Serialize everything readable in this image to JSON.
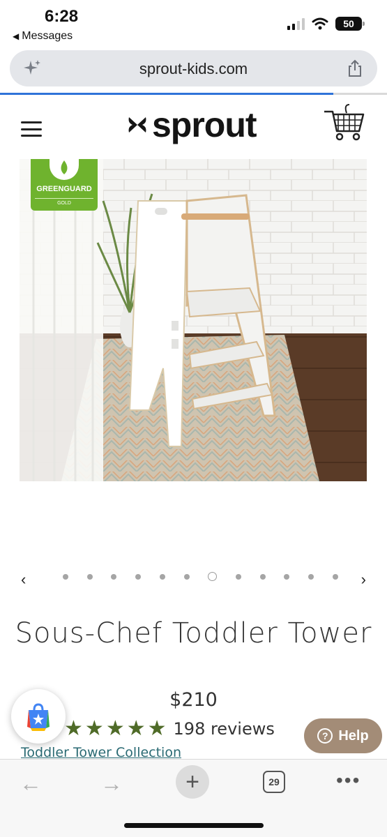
{
  "status_bar": {
    "time": "6:28",
    "back_label": "Messages",
    "battery": "50"
  },
  "address_bar": {
    "url": "sprout-kids.com",
    "icons": [
      "sparkle-icon",
      "share-icon"
    ]
  },
  "site_header": {
    "logo_text": "sprout",
    "icons": [
      "menu-icon",
      "cart-icon"
    ]
  },
  "product_image": {
    "badge_title": "GREENGUARD",
    "badge_level": "GOLD"
  },
  "carousel": {
    "dot_count": 12,
    "active_index": 6
  },
  "product": {
    "title": "Sous-Chef Toddler Tower",
    "price": "$210",
    "rating": 5,
    "reviews": "198 reviews",
    "collection_link": "Toddler Tower Collection"
  },
  "help_button": {
    "label": "Help"
  },
  "browser_toolbar": {
    "tab_count": "29"
  },
  "colors": {
    "accent_blue": "#2f73d9",
    "star_green": "#4f6b28",
    "link_teal": "#2a6a73",
    "help_brown": "#a38c77",
    "badge_green": "#6fb32e"
  }
}
